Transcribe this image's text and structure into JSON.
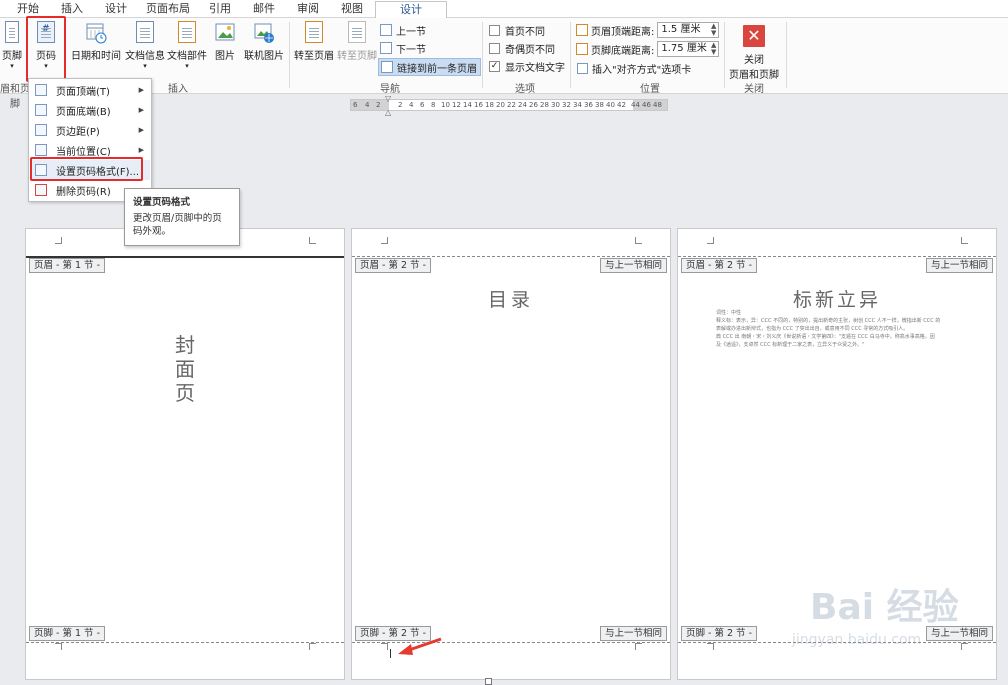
{
  "tabs": [
    {
      "label": "开始"
    },
    {
      "label": "插入"
    },
    {
      "label": "设计"
    },
    {
      "label": "页面布局"
    },
    {
      "label": "引用"
    },
    {
      "label": "邮件"
    },
    {
      "label": "审阅"
    },
    {
      "label": "视图"
    },
    {
      "label": "设计",
      "active": true
    }
  ],
  "ribbon": {
    "footer_btn": "页脚",
    "pagenum_btn": "页码",
    "datetime_btn": "日期和时间",
    "docinfo_btn": "文档信息",
    "docparts_btn": "文档部件",
    "picture_btn": "图片",
    "online_picture_btn": "联机图片",
    "goto_header_btn": "转至页眉",
    "goto_footer_btn": "转至页脚",
    "prev_btn": "上一节",
    "next_btn": "下一节",
    "link_prev_btn": "链接到前一条页眉",
    "diff_first": "首页不同",
    "diff_odd_even": "奇偶页不同",
    "show_doc_text": "显示文档文字",
    "header_top_label": "页眉顶端距离:",
    "header_top_value": "1.5 厘米",
    "footer_bottom_label": "页脚底端距离:",
    "footer_bottom_value": "1.75 厘米",
    "insert_align_tab": "插入\"对齐方式\"选项卡",
    "close_btn_line1": "关闭",
    "close_btn_line2": "页眉和页脚",
    "groups": {
      "hf": "眉和页脚",
      "insert": "插入",
      "nav": "导航",
      "options": "选项",
      "position": "位置",
      "close": "关闭"
    }
  },
  "ruler": {
    "left_numbers": [
      "6",
      "4",
      "2"
    ],
    "numbers": [
      "2",
      "4",
      "6",
      "8",
      "10",
      "12",
      "14",
      "16",
      "18",
      "20",
      "22",
      "24",
      "26",
      "28",
      "30",
      "32",
      "34",
      "36",
      "38",
      "40",
      "42",
      "44",
      "46",
      "48"
    ]
  },
  "dropdown": {
    "items": [
      {
        "label": "页面顶端(T)",
        "sub": true
      },
      {
        "label": "页面底端(B)",
        "sub": true
      },
      {
        "label": "页边距(P)",
        "sub": true
      },
      {
        "label": "当前位置(C)",
        "sub": true
      },
      {
        "label": "设置页码格式(F)...",
        "sub": false
      },
      {
        "label": "删除页码(R)",
        "sub": false
      }
    ]
  },
  "tooltip": {
    "title": "设置页码格式",
    "body": "更改页眉/页脚中的页码外观。"
  },
  "pages": [
    {
      "header": "页眉 - 第 1 节 -",
      "footer": "页脚 - 第 1 节 -",
      "same": ""
    },
    {
      "header": "页眉 - 第 2 节 -",
      "footer": "页脚 - 第 2 节 -",
      "same": "与上一节相同"
    },
    {
      "header": "页眉 - 第 2 节 -",
      "footer": "页脚 - 第 2 节 -",
      "same": "与上一节相同"
    }
  ],
  "cover": {
    "line1": "封",
    "line2": "面",
    "line3": "页"
  },
  "toc": {
    "title": "目录"
  },
  "page3": {
    "title": "标新立异",
    "lines": [
      "词性：中性",
      "释义标：表示，异：CCC 不同的，特别的，提出新奇的主张，树创 CCC 人不一样，微指出新 CCC 的",
      "表解或办进出新辩式，也指为 CCC 了突出出自，或意用不同 CCC 寻常的方式吸引人。",
      "典 CCC 出 南朝・宋・刘义庆《世说新语・文学第四》：\"支遁在 CCC 白马寺中，称高水事高格，因",
      "及《逍遥》，支卓然 CCC 标新理于二家之表，立异义于众贤之外。\""
    ]
  },
  "watermark": {
    "text": "Bai 经验",
    "sub": "jingyan.baidu.com"
  },
  "colors": {
    "accent": "#2b5797",
    "highlight": "#e52b2b",
    "arrow": "#e8392f"
  }
}
